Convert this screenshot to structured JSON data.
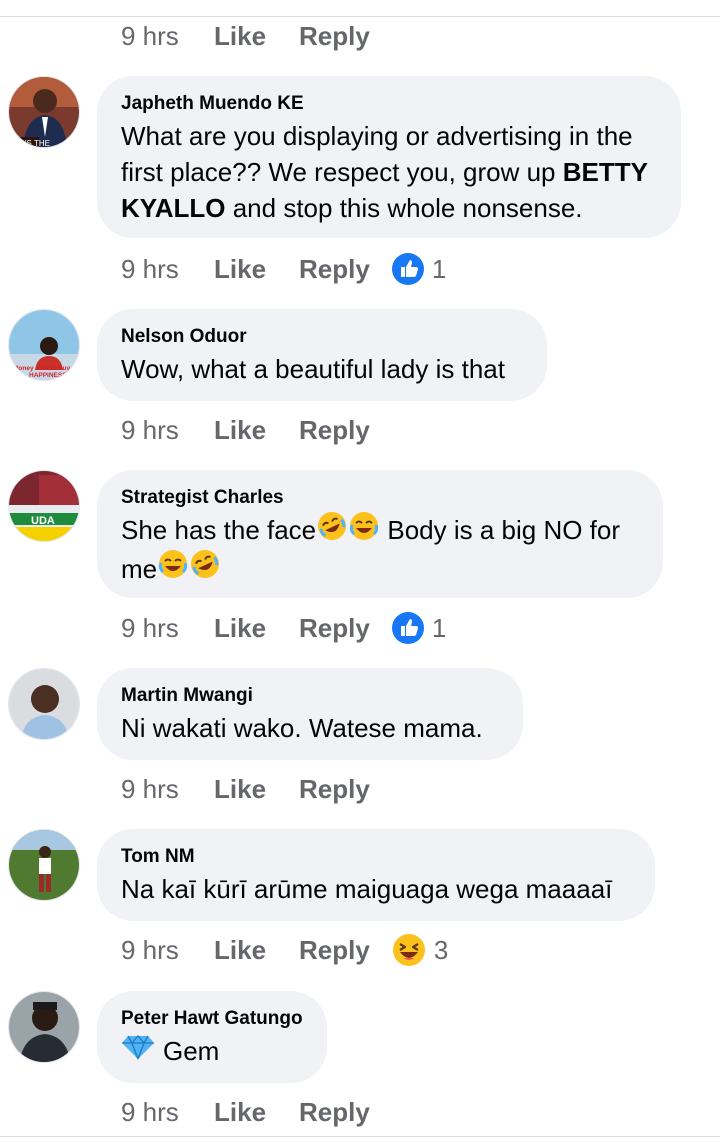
{
  "actions": {
    "like": "Like",
    "reply": "Reply"
  },
  "comments": [
    {
      "time": "9 hrs"
    },
    {
      "author": "Japheth Muendo KE",
      "avatar_caption": "ER IS THE",
      "text_a": "What are you displaying or advertising in the first place?? We respect you, grow up ",
      "text_bold": "BETTY KYALLO",
      "text_b": "  and stop this whole nonsense.",
      "time": "9 hrs",
      "reaction_icon": "like-icon",
      "reaction_count": "1"
    },
    {
      "author": "Nelson Oduor",
      "avatar_caption": "Money cannot buy HAPPINESS",
      "text": "Wow, what a beautiful lady is that",
      "time": "9 hrs"
    },
    {
      "author": "Strategist Charles",
      "avatar_caption": "UDA",
      "text_a": "She has the face",
      "text_b": " Body is a big NO for me",
      "time": "9 hrs",
      "reaction_icon": "like-icon",
      "reaction_count": "1"
    },
    {
      "author": "Martin Mwangi",
      "text": "Ni wakati wako. Watese mama.",
      "time": "9 hrs"
    },
    {
      "author": "Tom NM",
      "text": "Na kaī kūrī arūme maiguaga wega maaaaī",
      "time": "9 hrs",
      "reaction_icon": "haha-icon",
      "reaction_count": "3"
    },
    {
      "author": "Peter Hawt Gatungo",
      "text": "Gem",
      "time": "9 hrs"
    }
  ],
  "colors": {
    "bubble": "#f0f2f5",
    "meta": "#65676b",
    "like_blue": "#1877f2",
    "emoji_yellow": "#fcc21b"
  }
}
